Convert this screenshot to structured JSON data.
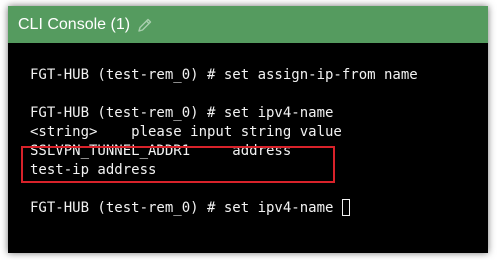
{
  "window": {
    "title": "CLI Console (1)",
    "edit_icon": "pencil-icon"
  },
  "console": {
    "lines": [
      "FGT-HUB (test-rem_0) # set assign-ip-from name",
      "",
      "FGT-HUB (test-rem_0) # set ipv4-name",
      "<string>    please input string value",
      "SSLVPN_TUNNEL_ADDR1     address",
      "test-ip address",
      "",
      "FGT-HUB (test-rem_0) # set ipv4-name "
    ]
  },
  "colors": {
    "titlebar": "#559b5f",
    "console_bg": "#000000",
    "console_text": "#f2f2f2",
    "highlight": "#d8222a"
  }
}
